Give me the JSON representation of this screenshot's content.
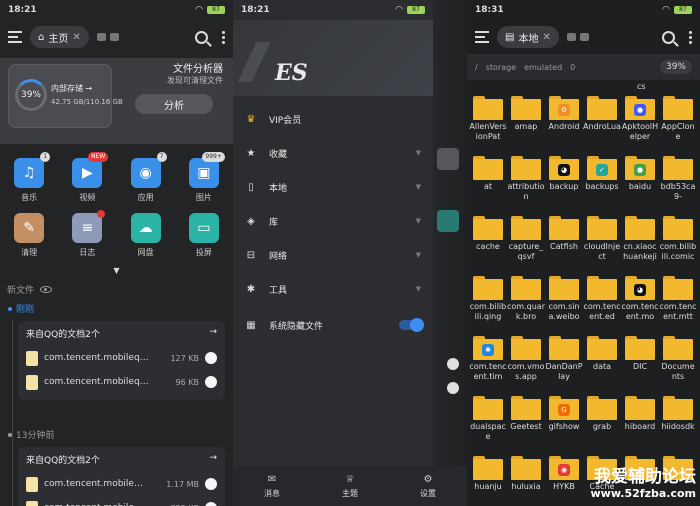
{
  "panel1": {
    "status": {
      "time": "18:21",
      "battery": "87"
    },
    "tab_label": "主页",
    "storage": {
      "percent": "39%",
      "label": "内部存储 →",
      "size": "42.75 GB/110.16 GB",
      "analyzer_title": "文件分析器",
      "analyzer_sub": "发现可清理文件",
      "analyze_button": "分析"
    },
    "categories": [
      {
        "label": "音乐",
        "badge": "1",
        "color": "#3a8fe8",
        "icon": "music-icon",
        "glyph": "♫"
      },
      {
        "label": "视频",
        "badge": "NEW",
        "color": "#3a8fe8",
        "icon": "video-icon",
        "glyph": "▶"
      },
      {
        "label": "应用",
        "badge": "7",
        "color": "#3a8fe8",
        "icon": "android-icon",
        "glyph": "◉"
      },
      {
        "label": "图片",
        "badge": "999+",
        "color": "#3a8fe8",
        "icon": "image-icon",
        "glyph": "▣"
      },
      {
        "label": "清理",
        "badge": "",
        "color": "#c49063",
        "icon": "broom-icon",
        "glyph": "✎"
      },
      {
        "label": "日志",
        "badge": "",
        "color": "#8d9ab8",
        "icon": "log-icon",
        "glyph": "≡"
      },
      {
        "label": "网盘",
        "badge": "",
        "color": "#2bb3a6",
        "icon": "cloud-icon",
        "glyph": "☁"
      },
      {
        "label": "投屏",
        "badge": "",
        "color": "#2bb3a6",
        "icon": "cast-icon",
        "glyph": "▭"
      }
    ],
    "recent_title": "新文件",
    "groups": [
      {
        "time": "刚刚",
        "title": "来自QQ的文档2个",
        "files": [
          {
            "name": "com.tencent.mobileq…",
            "size": "127 KB"
          },
          {
            "name": "com.tencent.mobileq…",
            "size": "96 KB"
          }
        ]
      },
      {
        "time": "13分钟前",
        "title": "来自QQ的文档2个",
        "files": [
          {
            "name": "com.tencent.mobile…",
            "size": "1.17 MB"
          },
          {
            "name": "com.tencent.mobile…",
            "size": "723 KB"
          }
        ]
      }
    ]
  },
  "panel2": {
    "status": {
      "time": "18:21",
      "battery": "87"
    },
    "logo": "ES",
    "menu": [
      {
        "label": "VIP会员",
        "icon": "crown-icon",
        "glyph": "♛",
        "chevron": false
      },
      {
        "label": "收藏",
        "icon": "star-icon",
        "glyph": "★",
        "chevron": true
      },
      {
        "label": "本地",
        "icon": "phone-icon",
        "glyph": "▯",
        "chevron": true
      },
      {
        "label": "库",
        "icon": "layers-icon",
        "glyph": "◈",
        "chevron": true
      },
      {
        "label": "网络",
        "icon": "network-icon",
        "glyph": "⊟",
        "chevron": true
      },
      {
        "label": "工具",
        "icon": "wrench-icon",
        "glyph": "✱",
        "chevron": true
      },
      {
        "label": "系统隐藏文件",
        "icon": "hidden-file-icon",
        "glyph": "▦",
        "toggle": true
      }
    ],
    "bottom": [
      {
        "label": "消息",
        "icon": "message-icon",
        "glyph": "✉"
      },
      {
        "label": "主题",
        "icon": "shirt-icon",
        "glyph": "♕"
      },
      {
        "label": "设置",
        "icon": "gear-icon",
        "glyph": "⚙"
      }
    ]
  },
  "panel3": {
    "status": {
      "time": "18:31",
      "battery": "87"
    },
    "tab_label": "本地",
    "path": [
      "/",
      "storage",
      "emulated",
      "0"
    ],
    "percent": "39%",
    "partial_top": "cs",
    "folders": [
      {
        "name": "AllenVersionPat",
        "mark": ""
      },
      {
        "name": "amap",
        "mark": ""
      },
      {
        "name": "Android",
        "mark": "gear"
      },
      {
        "name": "AndroLua",
        "mark": ""
      },
      {
        "name": "ApktoolHelper",
        "mark": "app"
      },
      {
        "name": "AppClone",
        "mark": ""
      },
      {
        "name": "at",
        "mark": ""
      },
      {
        "name": "attribution",
        "mark": ""
      },
      {
        "name": "backup",
        "mark": "qq"
      },
      {
        "name": "backups",
        "mark": "check"
      },
      {
        "name": "baidu",
        "mark": "green"
      },
      {
        "name": "bdb53ca9-",
        "mark": ""
      },
      {
        "name": "cache",
        "mark": ""
      },
      {
        "name": "capture_qsvf",
        "mark": ""
      },
      {
        "name": "Catfish",
        "mark": ""
      },
      {
        "name": "cloudInject",
        "mark": ""
      },
      {
        "name": "cn.xiaochuankeji",
        "mark": ""
      },
      {
        "name": "com.bilibili.comic",
        "mark": ""
      },
      {
        "name": "com.bilibili.qing",
        "mark": ""
      },
      {
        "name": "com.quark.bro",
        "mark": ""
      },
      {
        "name": "com.sina.weibo",
        "mark": ""
      },
      {
        "name": "com.tencent.ed",
        "mark": ""
      },
      {
        "name": "com.tencent.mo",
        "mark": "qq"
      },
      {
        "name": "com.tencent.mtt",
        "mark": ""
      },
      {
        "name": "com.tencent.tim",
        "mark": "tim"
      },
      {
        "name": "com.vmos.app",
        "mark": ""
      },
      {
        "name": "DanDanPlay",
        "mark": ""
      },
      {
        "name": "data",
        "mark": ""
      },
      {
        "name": "DIC",
        "mark": ""
      },
      {
        "name": "Documents",
        "mark": ""
      },
      {
        "name": "dualspace",
        "mark": ""
      },
      {
        "name": "Geetest",
        "mark": ""
      },
      {
        "name": "gifshow",
        "mark": "gif"
      },
      {
        "name": "grab",
        "mark": ""
      },
      {
        "name": "hiboard",
        "mark": ""
      },
      {
        "name": "hiidosdk",
        "mark": ""
      },
      {
        "name": "huanju",
        "mark": ""
      },
      {
        "name": "huluxia",
        "mark": ""
      },
      {
        "name": "HYKB",
        "mark": "wx"
      },
      {
        "name": "Cache",
        "mark": ""
      },
      {
        "name": "",
        "mark": ""
      },
      {
        "name": "",
        "mark": ""
      }
    ],
    "watermark_1": "我爱辅助论坛",
    "watermark_2": "www.52fzba.com"
  }
}
